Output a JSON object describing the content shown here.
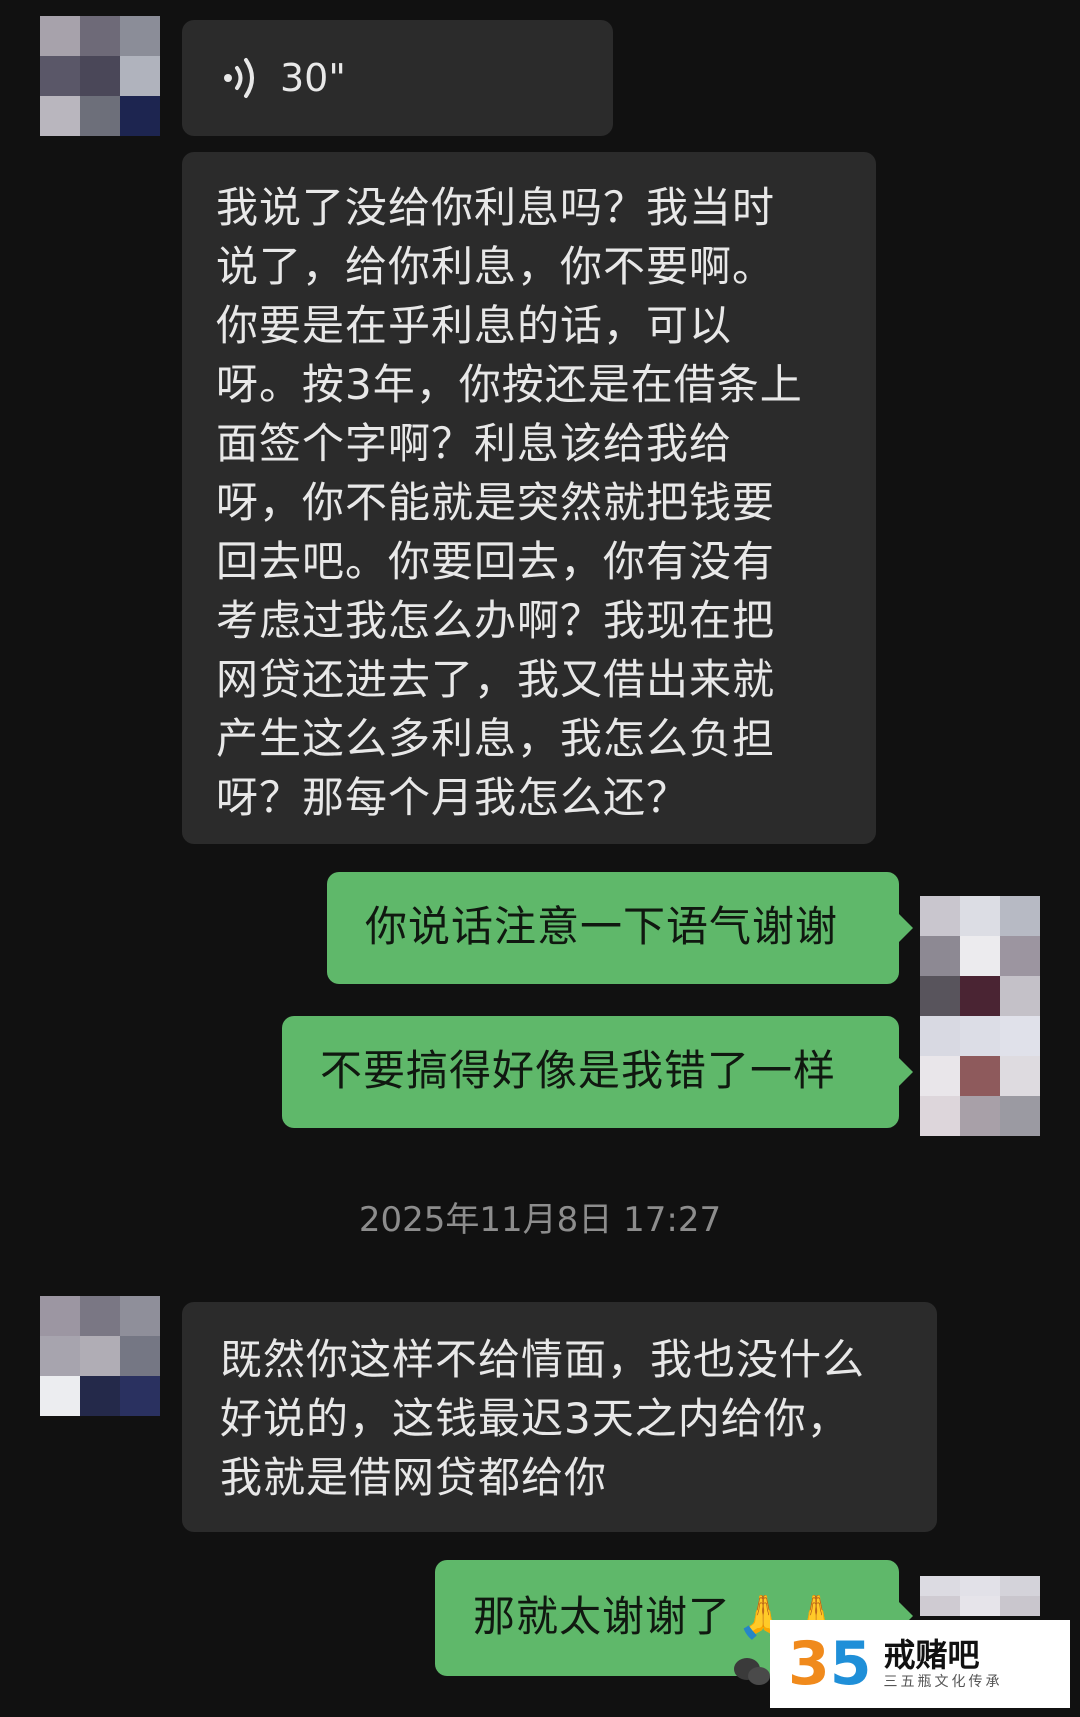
{
  "colors": {
    "background": "#111111",
    "incoming_bubble": "#2b2b2b",
    "outgoing_bubble": "#5fb86a",
    "timestamp_text": "#8d8d8d"
  },
  "messages": {
    "voice": {
      "icon": "voice-wave-icon",
      "duration": "30\""
    },
    "incoming_1": {
      "lines": [
        "我说了没给你利息吗？我当时",
        "说了，给你利息，你不要啊。",
        "你要是在乎利息的话，可以",
        "呀。按3年，你按还是在借条上",
        "面签个字啊？利息该给我给",
        "呀，你不能就是突然就把钱要",
        "回去吧。你要回去，你有没有",
        "考虑过我怎么办啊？我现在把",
        "网贷还进去了，我又借出来就",
        "产生这么多利息，我怎么负担",
        "呀？那每个月我怎么还？"
      ]
    },
    "outgoing_1": {
      "text": "你说话注意一下语气谢谢"
    },
    "outgoing_2": {
      "text": "不要搞得好像是我错了一样"
    },
    "timestamp": "2025年11月8日 17:27",
    "incoming_2": {
      "lines": [
        "既然你这样不给情面，我也没什么",
        "好说的，这钱最迟3天之内给你，",
        "我就是借网贷都给你"
      ]
    },
    "outgoing_3": {
      "text": "那就太谢谢了",
      "emoji": "🙏🙏"
    }
  },
  "watermark": {
    "logo_digits": [
      "3",
      "5"
    ],
    "title": "戒赌吧",
    "subtitle": "三五瓶文化传承"
  }
}
